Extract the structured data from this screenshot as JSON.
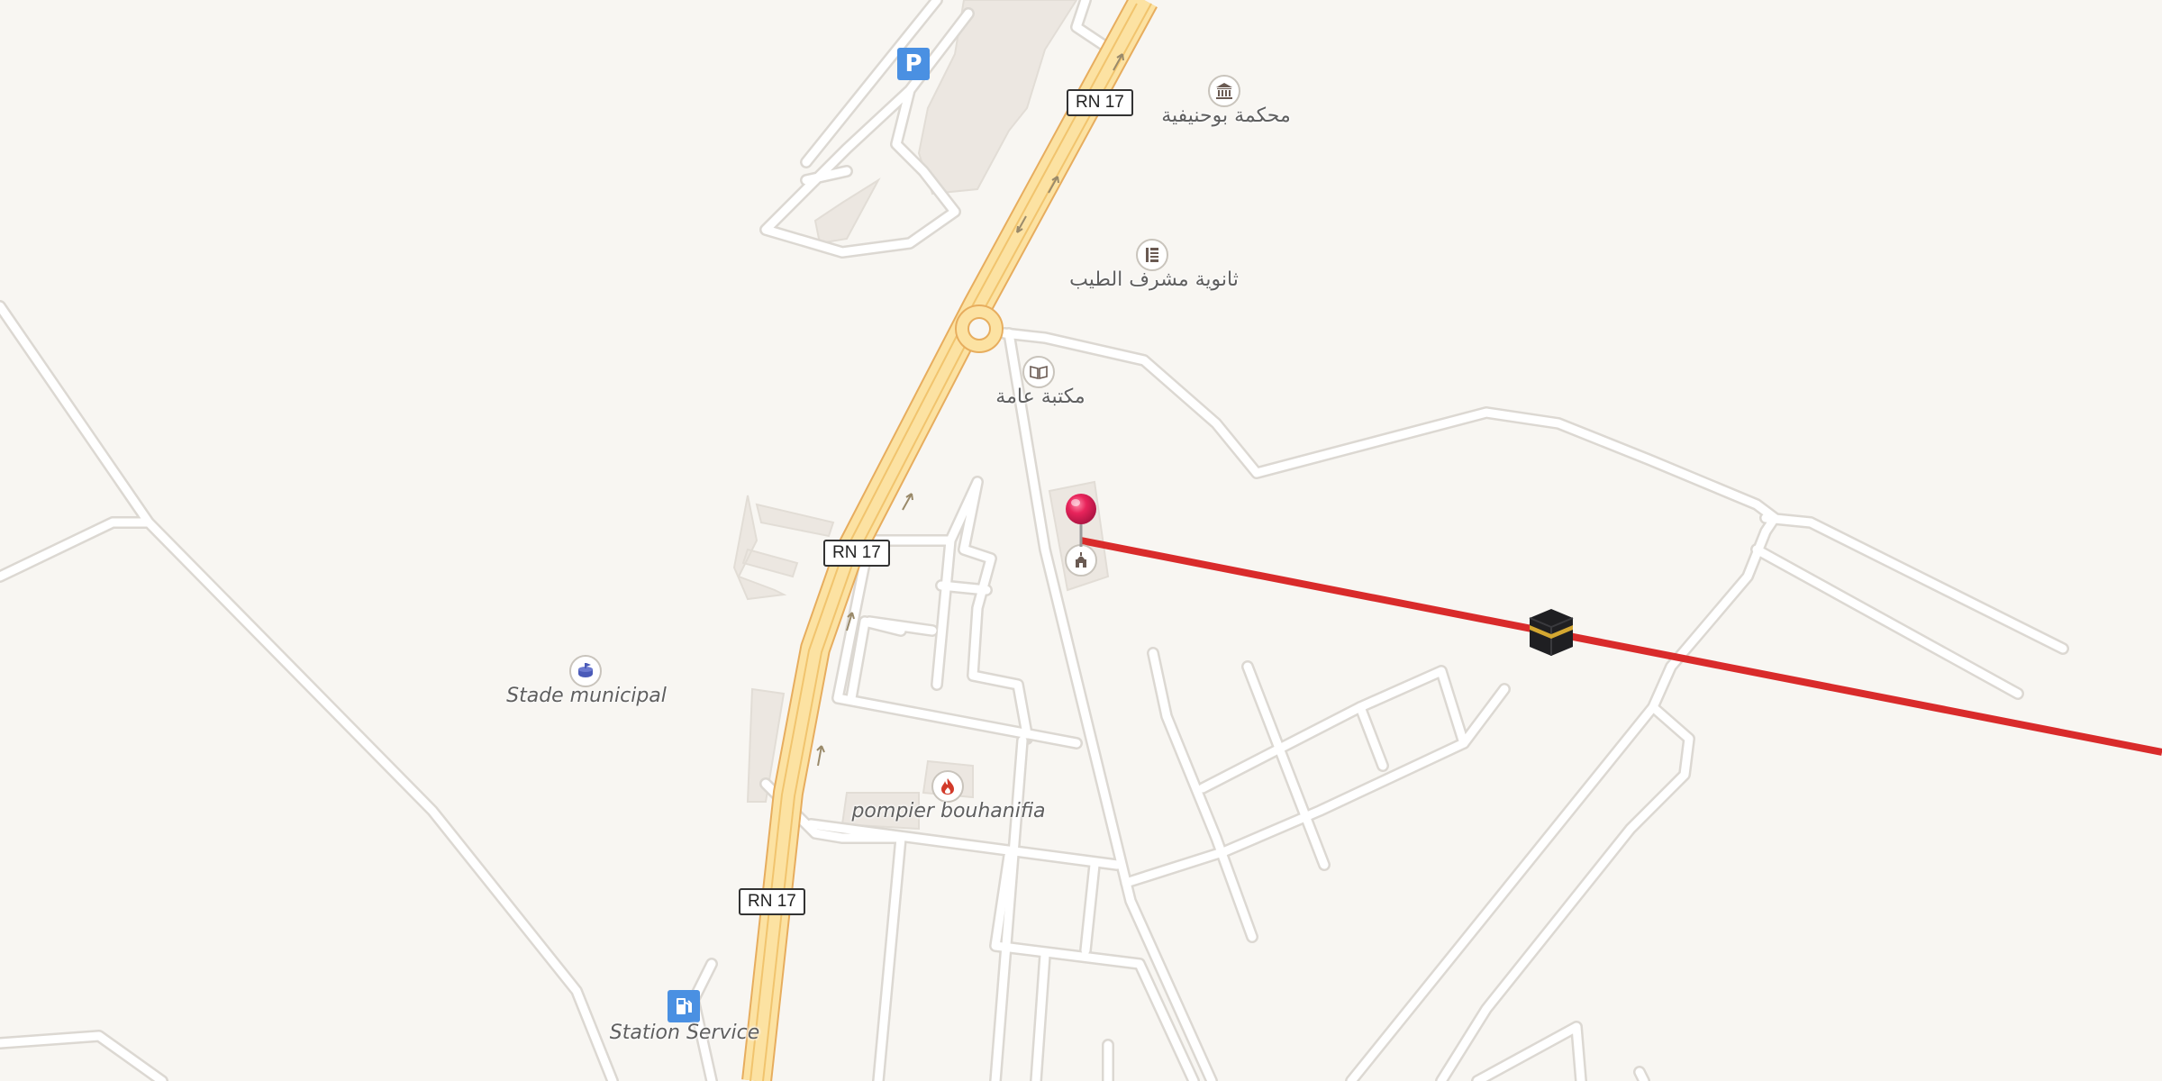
{
  "map": {
    "colors": {
      "background": "#f8f6f2",
      "road_fill": "#ffffff",
      "road_casing": "#dcd8d2",
      "highway_fill": "#fce2a2",
      "highway_casing": "#e7ad5e",
      "building": "#ece7e1",
      "route_line": "#d92b2b",
      "pin": "#e8245b",
      "poi_icon": "#6a5a52",
      "parking": "#4a90e2",
      "fuel": "#4a90e2",
      "stadium": "#4a5ab8",
      "fire": "#d23a2a"
    },
    "road_shields": [
      "RN 17",
      "RN 17",
      "RN 17"
    ],
    "pois": {
      "court": {
        "label": "محكمة بوحنيفية",
        "icon": "courthouse-icon"
      },
      "school": {
        "label": "ثانوية مشرف الطيب",
        "icon": "school-icon"
      },
      "library": {
        "label": "مكتبة عامة",
        "icon": "library-book-icon"
      },
      "mosque": {
        "icon": "mosque-icon"
      },
      "stadium": {
        "label": "Stade municipal",
        "icon": "stadium-icon"
      },
      "fire_station": {
        "label": "pompier bouhanifia",
        "icon": "fire-icon"
      },
      "fuel": {
        "label": "Station Service",
        "icon": "fuel-pump-icon"
      },
      "parking": {
        "glyph": "P",
        "icon": "parking-icon"
      },
      "kaaba": {
        "icon": "kaaba-icon"
      },
      "pin": {
        "icon": "location-pin-icon"
      }
    }
  }
}
